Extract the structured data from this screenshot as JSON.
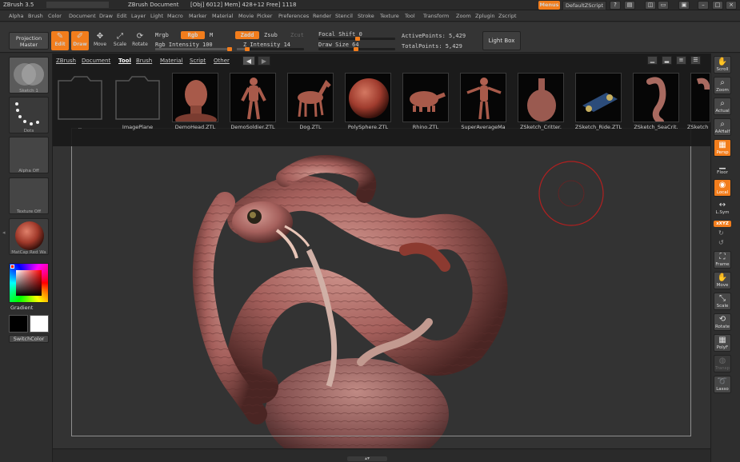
{
  "app": {
    "title": "ZBrush 3.5",
    "document": "ZBrush Document",
    "obj_readout": "[Obj] 6012] Mem] 428+12 Free] 1118",
    "menus_label": "Menus",
    "default_script": "DefaultZScript"
  },
  "menubar": [
    "Alpha",
    "Brush",
    "Color",
    "Document",
    "Draw",
    "Edit",
    "Layer",
    "Light",
    "Macro",
    "Marker",
    "Material",
    "Movie",
    "Picker",
    "Preferences",
    "Render",
    "Stencil",
    "Stroke",
    "Texture",
    "Tool",
    "Transform",
    "Zoom",
    "Zplugin",
    "Zscript"
  ],
  "toolbar": {
    "projection_master": "Projection Master",
    "edit": "Edit",
    "draw": "Draw",
    "move": "Move",
    "scale": "Scale",
    "rotate": "Rotate",
    "mrgb": "Mrgb",
    "rgb": "Rgb",
    "m": "M",
    "zadd": "Zadd",
    "zsub": "Zsub",
    "zcut": "Zcut",
    "rgb_intensity": "Rgb Intensity 100",
    "z_intensity": "Z Intensity 14",
    "focal_shift": "Focal Shift 0",
    "draw_size": "Draw Size 64",
    "active_points": "ActivePoints: 5,429",
    "total_points": "TotalPoints: 5,429",
    "light_box": "Light Box"
  },
  "toolpanel": {
    "tabs": [
      "ZBrush",
      "Document",
      "Tool",
      "Brush",
      "Material",
      "Script",
      "Other"
    ],
    "active_tab": "Tool",
    "items": [
      {
        "label": "..",
        "kind": "folder"
      },
      {
        "label": "ImagePlane",
        "kind": "folder"
      },
      {
        "label": "DemoHead.ZTL",
        "kind": "head"
      },
      {
        "label": "DemoSoldier.ZTL",
        "kind": "figure"
      },
      {
        "label": "Dog.ZTL",
        "kind": "dog"
      },
      {
        "label": "PolySphere.ZTL",
        "kind": "sphere"
      },
      {
        "label": "Rhino.ZTL",
        "kind": "rhino"
      },
      {
        "label": "SuperAverageMa",
        "kind": "figure"
      },
      {
        "label": "ZSketch_Critter.",
        "kind": "critter"
      },
      {
        "label": "ZSketch_Ride.ZTL",
        "kind": "ride"
      },
      {
        "label": "ZSketch_SeaCrit.",
        "kind": "seacrit"
      },
      {
        "label": "ZSketch",
        "kind": "seacrit"
      }
    ]
  },
  "leftshelf": {
    "sketch": "Sketch 1",
    "dots": "Dots",
    "alpha": "Alpha Off",
    "texture": "Texture Off",
    "material": "MatCap Red Wa",
    "gradient": "Gradient",
    "switch_color": "SwitchColor"
  },
  "rightshelf": [
    "Scroll",
    "Zoom",
    "Actual",
    "AAHalf",
    "Persp",
    "Floor",
    "Local",
    "L.Sym",
    "xXYZ",
    "Frame",
    "Move",
    "Scale",
    "Rotate",
    "PolyF",
    "Transp",
    "Lasso"
  ],
  "colors": {
    "accent": "#f27d1c",
    "bg": "#2c2c2c",
    "model": "#b36b6b"
  }
}
